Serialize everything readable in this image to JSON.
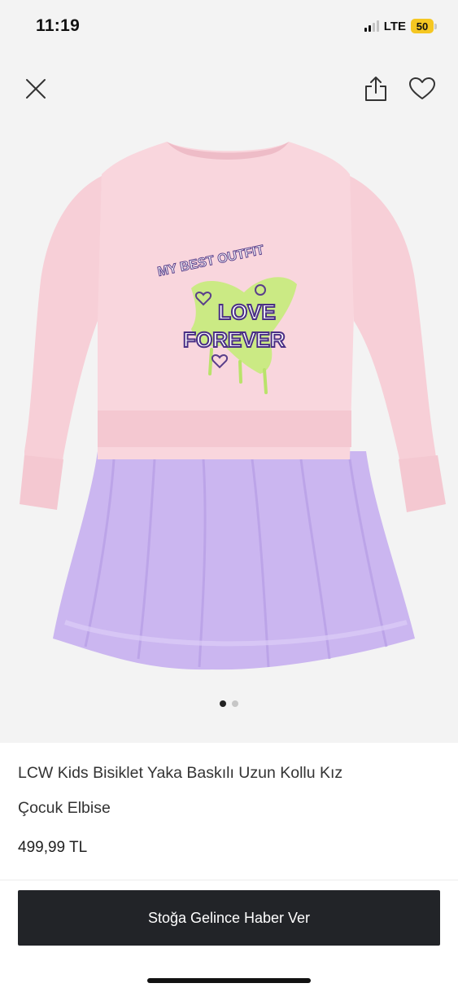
{
  "status": {
    "time": "11:19",
    "network": "LTE",
    "battery": "50"
  },
  "header": {
    "icons": [
      "close-icon",
      "share-icon",
      "heart-icon"
    ]
  },
  "gallery": {
    "image_count": 2,
    "active_index": 0,
    "print_text": [
      "MY BEST OUTFIT",
      "LOVE",
      "FOREVER"
    ]
  },
  "product": {
    "title_line1": "LCW Kids Bisiklet Yaka Baskılı Uzun Kollu Kız",
    "title_line2": "Çocuk Elbise",
    "price": "499,99 TL"
  },
  "cta": {
    "label": "Stoğa Gelince Haber Ver"
  },
  "colors": {
    "accent": "#222428",
    "sweatshirt": "#f9d6dd",
    "tulle": "#c9b3ef"
  }
}
